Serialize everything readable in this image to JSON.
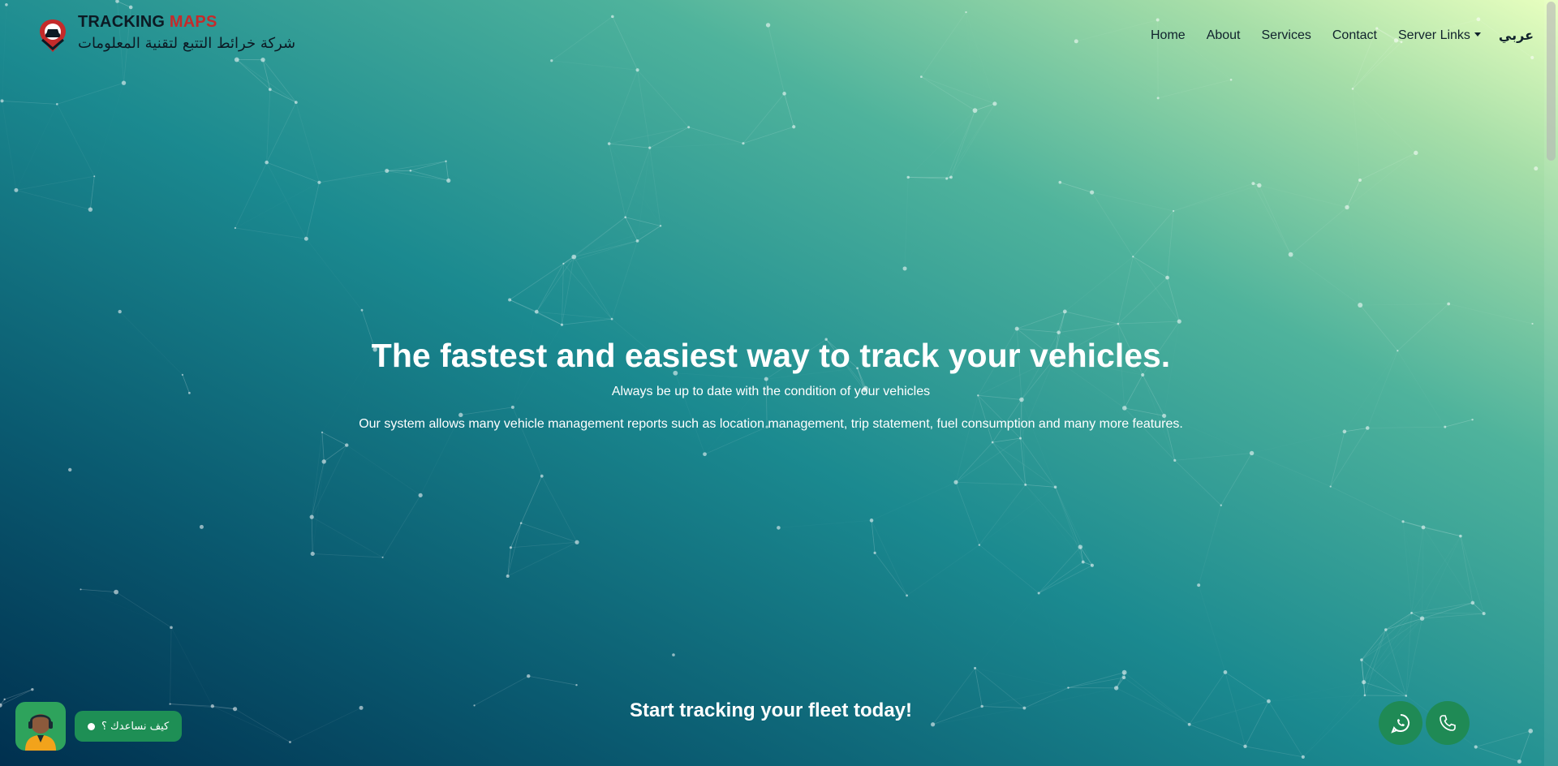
{
  "brand": {
    "title_main": "TRACKING",
    "title_accent": "MAPS",
    "subtitle": "شركة خرائط التتبع لتقنية المعلومات",
    "accent_color": "#c42b2b"
  },
  "nav": {
    "home": "Home",
    "about": "About",
    "services": "Services",
    "contact": "Contact",
    "server_links": "Server Links",
    "language": "عربي"
  },
  "hero": {
    "title": "The fastest and easiest way to track your vehicles.",
    "subtitle": "Always be up to date with the condition of your vehicles",
    "description": "Our system allows many vehicle management reports such as location management, trip statement, fuel consumption and many more features.",
    "cta": "Start tracking your fleet today!"
  },
  "chat": {
    "label": "كيف نساعدك ؟",
    "color": "#1e8f55"
  },
  "icons": {
    "logo": "location-pin-car-icon",
    "whatsapp": "whatsapp-icon",
    "phone": "phone-icon",
    "support": "support-agent-icon"
  }
}
